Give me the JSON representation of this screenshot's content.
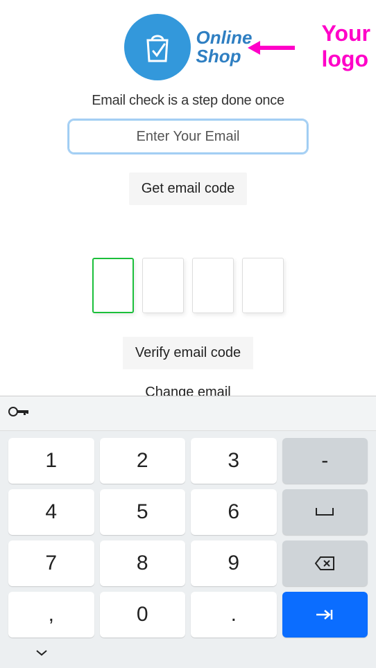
{
  "logo": {
    "line1": "Online",
    "line2": "Shop"
  },
  "annotation": {
    "line1": "Your",
    "line2": "logo"
  },
  "subtitle": "Email check is a step done once",
  "email": {
    "placeholder": "Enter Your Email"
  },
  "buttons": {
    "get_code": "Get email code",
    "verify": "Verify email code",
    "change": "Change email"
  },
  "keyboard": {
    "keys": {
      "k1": "1",
      "k2": "2",
      "k3": "3",
      "dash": "-",
      "k4": "4",
      "k5": "5",
      "k6": "6",
      "space": "␣",
      "k7": "7",
      "k8": "8",
      "k9": "9",
      "comma": ",",
      "k0": "0",
      "period": "."
    }
  }
}
